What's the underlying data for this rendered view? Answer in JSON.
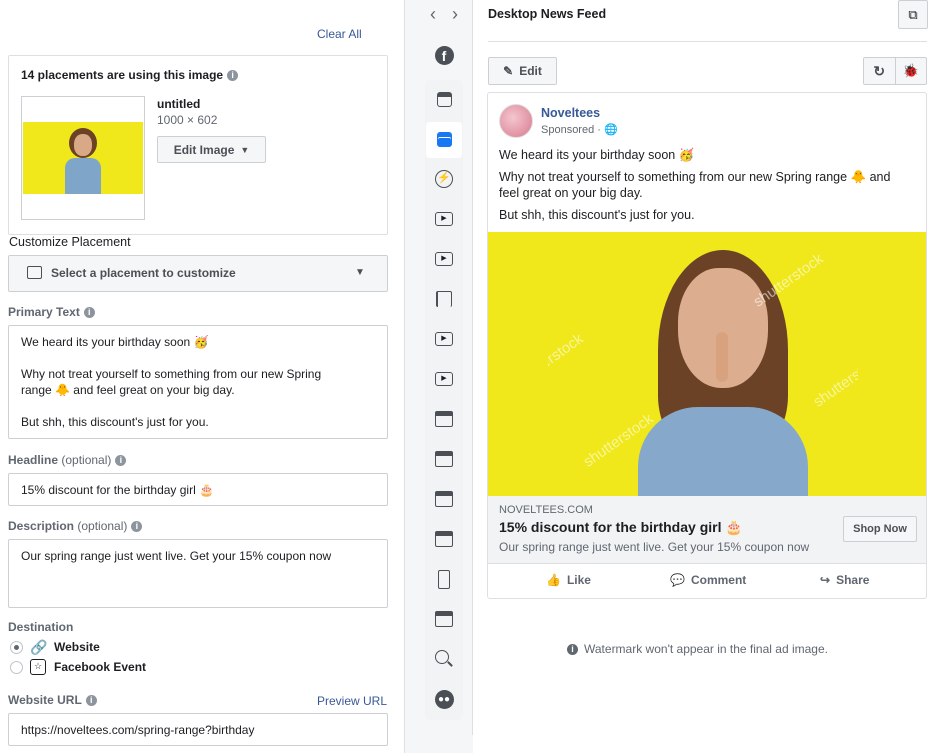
{
  "editor": {
    "clear_all": "Clear All",
    "placements_text": "14 placements are using this image",
    "image_name": "untitled",
    "image_dims": "1000 × 602",
    "edit_image": "Edit Image",
    "customize_label": "Customize Placement",
    "select_placement": "Select a placement to customize",
    "primary_text_label": "Primary Text",
    "primary_text_lines": [
      "We heard its your birthday soon 🥳",
      "Why not treat yourself to something from our new Spring",
      "range 🐥 and feel great on your big day.",
      "But shh, this discount's just for you."
    ],
    "headline_label": "Headline",
    "optional": "(optional)",
    "headline_value": "15% discount for the birthday girl 🎂",
    "description_label": "Description",
    "description_value": "Our spring range just went live.  Get your 15% coupon now",
    "destination_label": "Destination",
    "dest_website": "Website",
    "dest_event": "Facebook Event",
    "website_url_label": "Website URL",
    "preview_url": "Preview URL",
    "website_url_value": "https://noveltees.com/spring-range?birthday"
  },
  "preview": {
    "title": "Desktop News Feed",
    "edit": "Edit",
    "page_name": "Noveltees",
    "sponsored": "Sponsored · ",
    "post_lines": [
      "We heard its your birthday soon 🥳",
      "Why not treat yourself to something from our new Spring range 🐥 and",
      "feel great on your big day.",
      "But shh, this discount's just for you."
    ],
    "domain": "NOVELTEES.COM",
    "headline": "15% discount for the birthday girl 🎂",
    "description": "Our spring range just went live. Get your 15% coupon now",
    "cta": "Shop Now",
    "like": "Like",
    "comment": "Comment",
    "share": "Share",
    "watermark_note": "Watermark won't appear in the final ad image.",
    "watermark_text": "shutterstock"
  },
  "colors": {
    "accent": "#385898",
    "ad_yellow": "#f0e81a",
    "fb_blue": "#1877f2"
  }
}
